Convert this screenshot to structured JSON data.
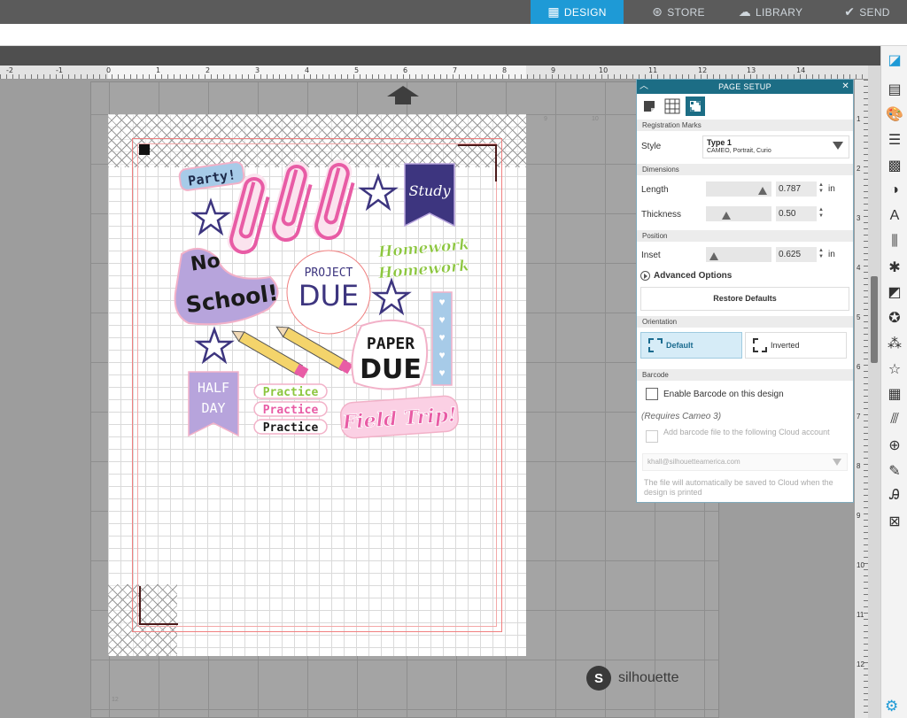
{
  "nav": {
    "design": "DESIGN",
    "store": "STORE",
    "library": "LIBRARY",
    "send": "SEND"
  },
  "ruler": {
    "h_numbers": [
      "-2",
      "-1",
      "0",
      "1",
      "2",
      "3",
      "4",
      "5",
      "6",
      "7",
      "8",
      "9",
      "10",
      "11",
      "12",
      "13",
      "14"
    ],
    "v_numbers": [
      "1",
      "2",
      "3",
      "4",
      "5",
      "6",
      "7",
      "8",
      "9",
      "10",
      "11",
      "12"
    ]
  },
  "page": {
    "corner_nums": [
      "9",
      "10",
      "12"
    ]
  },
  "stickers": {
    "party": "Party!",
    "study": "Study",
    "homework1": "Homework",
    "homework2": "Homework",
    "no_school_1": "No",
    "no_school_2": "School!",
    "project": "PROJECT",
    "due": "DUE",
    "paper": "PAPER",
    "paper_due": "DUE",
    "half": "HALF",
    "day": "DAY",
    "practice1": "Practice",
    "practice2": "Practice",
    "practice3": "Practice",
    "field_trip": "Field Trip!"
  },
  "brand": {
    "logo_letter": "S",
    "name": "silhouette"
  },
  "panel": {
    "title": "PAGE SETUP",
    "sections": {
      "registration": "Registration Marks",
      "dimensions": "Dimensions",
      "position": "Position",
      "orientation": "Orientation",
      "barcode": "Barcode"
    },
    "style_label": "Style",
    "style_value": "Type 1",
    "style_sub": "CAMEO, Portrait, Curio",
    "length_label": "Length",
    "length_value": "0.787",
    "length_fraction": 0.92,
    "thickness_label": "Thickness",
    "thickness_value": "0.50",
    "thickness_fraction": 0.28,
    "inset_label": "Inset",
    "inset_value": "0.625",
    "inset_fraction": 0.06,
    "unit_in": "in",
    "advanced": "Advanced Options",
    "restore": "Restore Defaults",
    "orient_default": "Default",
    "orient_inverted": "Inverted",
    "enable_barcode": "Enable Barcode on this design",
    "requires": "(Requires Cameo 3)",
    "add_barcode": "Add barcode file to the following Cloud account",
    "account": "khall@silhouetteamerica.com",
    "cloud_note": "The file will automatically be saved to Cloud when the design is printed"
  },
  "colors": {
    "accent": "#1e9ad6",
    "panel_header": "#1c6d85",
    "pink": "#e85ca5",
    "purple": "#3d357f",
    "green": "#8cc63f",
    "lavender": "#b7a4dc",
    "blue_light": "#a7cbe8"
  }
}
